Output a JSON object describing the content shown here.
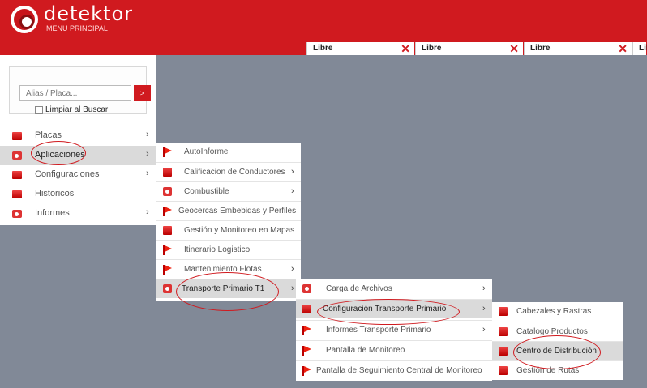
{
  "header": {
    "logo_text": "detektor",
    "subtitle": "MENU PRINCIPAL",
    "slots": [
      {
        "label": "Libre"
      },
      {
        "label": "Libre"
      },
      {
        "label": "Libre"
      },
      {
        "label": "Lib"
      }
    ],
    "close_glyph": "✕"
  },
  "search": {
    "placeholder": "Alias / Placa...",
    "button_label": ">",
    "clear_label": "Limpiar al Buscar"
  },
  "menu": {
    "items": [
      {
        "label": "Placas",
        "icon": "plate-icon"
      },
      {
        "label": "Aplicaciones",
        "icon": "apps-icon"
      },
      {
        "label": "Configuraciones",
        "icon": "config-icon"
      },
      {
        "label": "Historicos",
        "icon": "history-icon"
      },
      {
        "label": "Informes",
        "icon": "reports-icon"
      }
    ],
    "chevron": "›"
  },
  "submenu1": {
    "items": [
      {
        "label": "AutoInforme"
      },
      {
        "label": "Calificacion de Conductores"
      },
      {
        "label": "Combustible"
      },
      {
        "label": "Geocercas Embebidas y Perfiles"
      },
      {
        "label": "Gestión y Monitoreo en Mapas"
      },
      {
        "label": "Itinerario Logistico"
      },
      {
        "label": "Mantenimiento Flotas"
      },
      {
        "label": "Transporte Primario T1"
      }
    ]
  },
  "submenu2": {
    "items": [
      {
        "label": "Carga de Archivos"
      },
      {
        "label": "Configuración Transporte Primario"
      },
      {
        "label": "Informes Transporte Primario"
      },
      {
        "label": "Pantalla de Monitoreo"
      },
      {
        "label": "Pantalla de Seguimiento Central de Monitoreo"
      }
    ]
  },
  "submenu3": {
    "items": [
      {
        "label": "Cabezales y Rastras"
      },
      {
        "label": "Catalogo Productos"
      },
      {
        "label": "Centro de Distribución"
      },
      {
        "label": "Gestión de Rutas"
      }
    ]
  },
  "colors": {
    "brand_red": "#d01a1f",
    "background": "#818997",
    "menu_active": "#dadada"
  }
}
